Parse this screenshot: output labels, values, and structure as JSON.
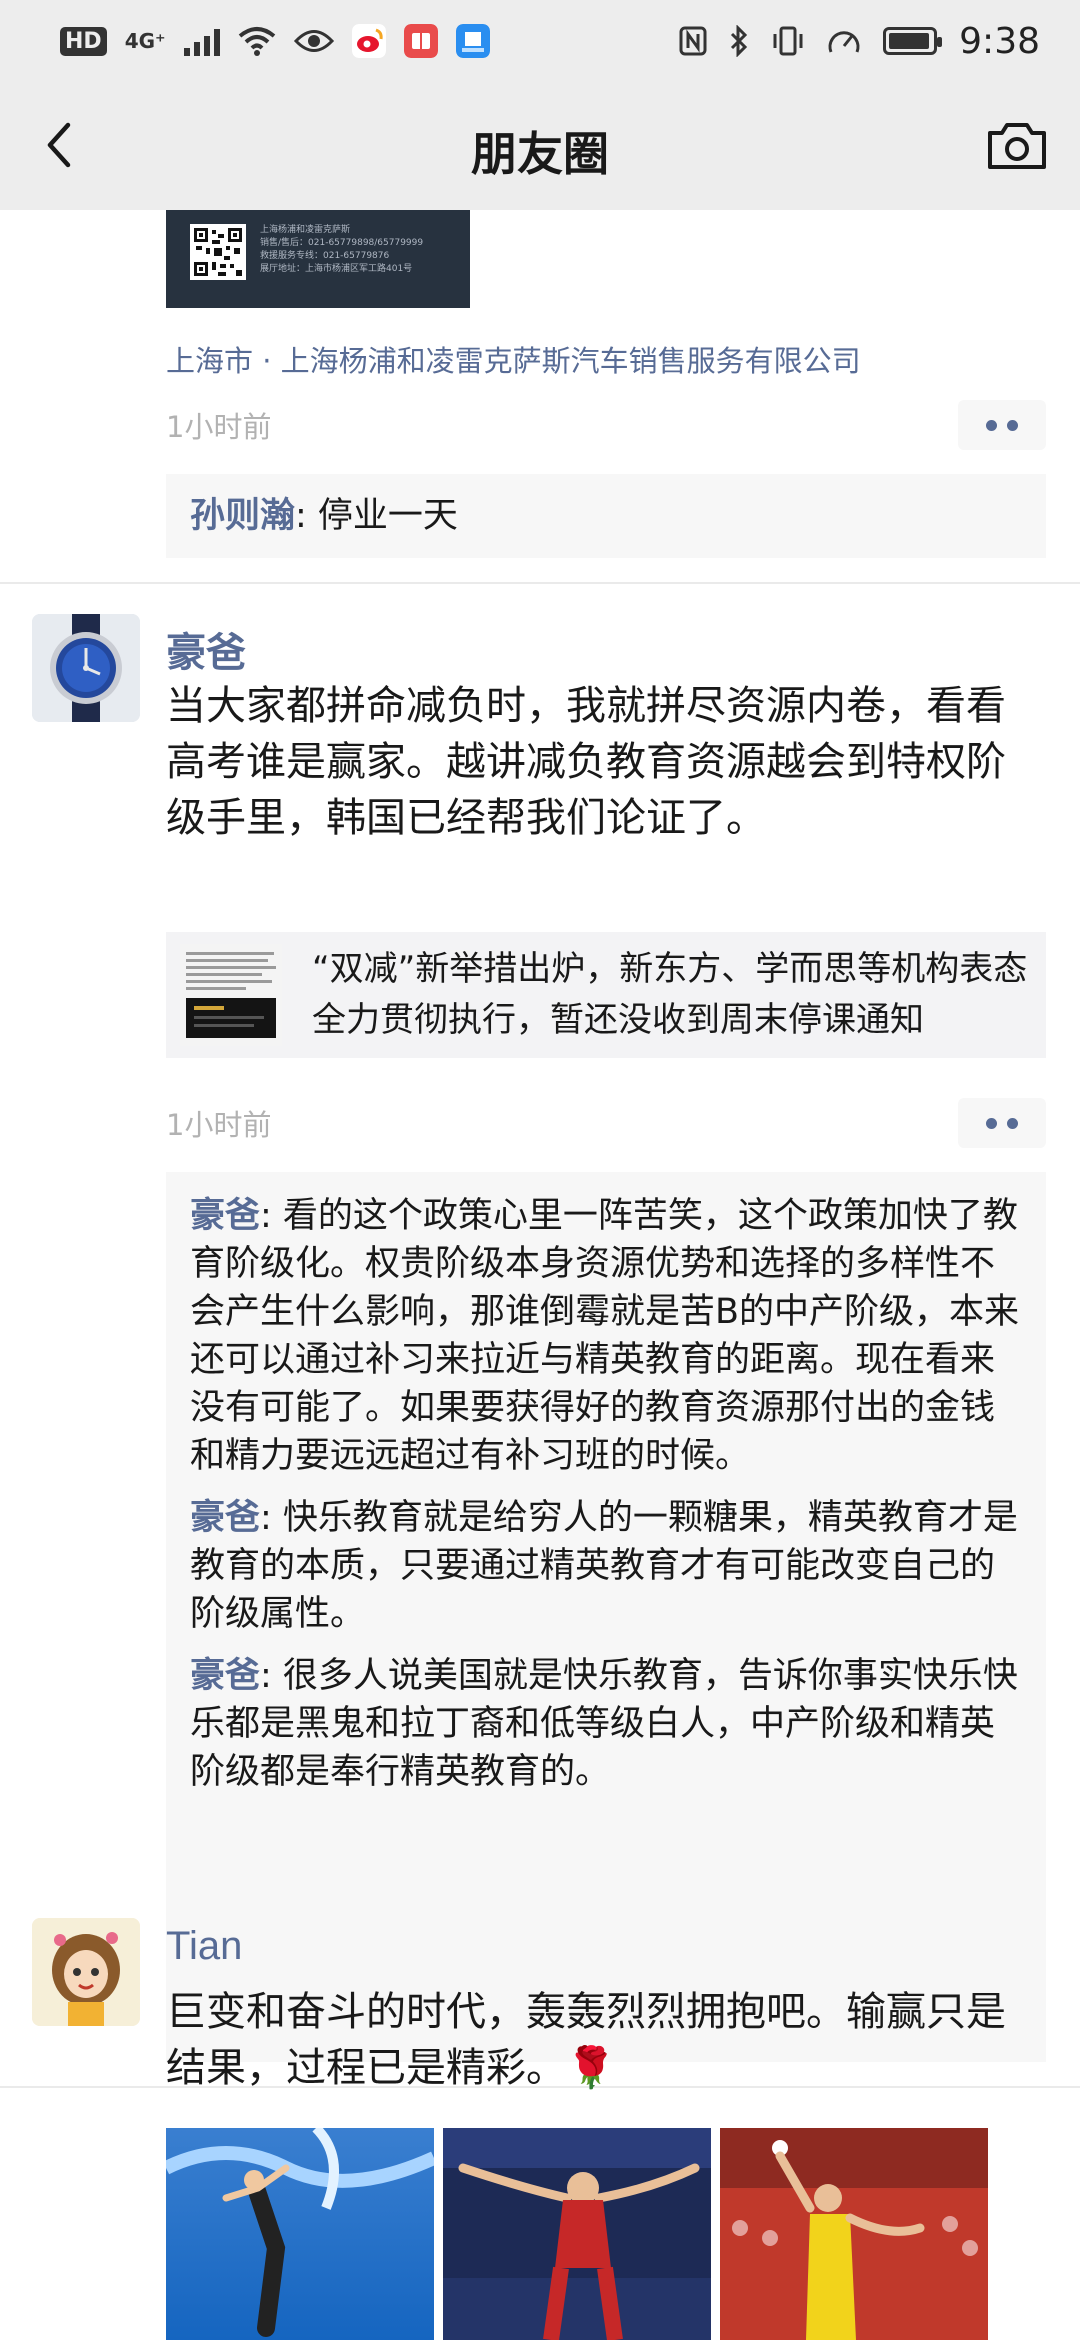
{
  "status_bar": {
    "hd_tag": "HD",
    "network": "4G⁺",
    "time": "9:38",
    "colors": {
      "app_weibo": "#e6162d",
      "app_book": "#e94b4b",
      "app_blue": "#2a8ef0"
    }
  },
  "nav": {
    "title": "朋友圈",
    "icons": [
      "back-icon",
      "camera-icon"
    ]
  },
  "post1": {
    "qr_card_lines": [
      "上海杨浦和凌雷克萨斯",
      "销售/售后：021-65779898/65779999",
      "救援服务专线：021-65779876",
      "展厅地址：上海市杨浦区军工路401号"
    ],
    "location": "上海市 · 上海杨浦和凌雷克萨斯汽车销售服务有限公司",
    "time": "1小时前",
    "comments": [
      {
        "author": "孙则瀚",
        "text": ": 停业一天"
      }
    ]
  },
  "post2": {
    "author": "豪爸",
    "text": "当大家都拼命减负时，我就拼尽资源内卷，看看高考谁是赢家。越讲减负教育资源越会到特权阶级手里，韩国已经帮我们论证了。",
    "link_title": "“双减”新举措出炉，新东方、学而思等机构表态全力贯彻执行，暂还没收到周末停课通知",
    "time": "1小时前",
    "comments": [
      {
        "author": "豪爸",
        "text": ": 看的这个政策心里一阵苦笑，这个政策加快了教育阶级化。权贵阶级本身资源优势和选择的多样性不会产生什么影响，那谁倒霉就是苦B的中产阶级，本来还可以通过补习来拉近与精英教育的距离。现在看来没有可能了。如果要获得好的教育资源那付出的金钱和精力要远远超过有补习班的时候。"
      },
      {
        "author": "豪爸",
        "text": ": 快乐教育就是给穷人的一颗糖果，精英教育才是教育的本质，只要通过精英教育才有可能改变自己的阶级属性。"
      },
      {
        "author": "豪爸",
        "text": ": 很多人说美国就是快乐教育，告诉你事实快乐快乐都是黑鬼和拉丁裔和低等级白人，中产阶级和精英阶级都是奉行精英教育的。"
      }
    ]
  },
  "post3": {
    "author": "Tian",
    "text": "巨变和奋斗的时代，轰轰烈烈拥抱吧。输赢只是结果，过程已是精彩。🌹",
    "photos": [
      "diving-photo",
      "gymnastics-photo",
      "volleyball-photo"
    ]
  },
  "accent_colors": {
    "link_blue": "#576b95",
    "time_gray": "#b2b2b2",
    "comment_bg": "#f7f7f7",
    "bar_bg": "#ededed"
  }
}
